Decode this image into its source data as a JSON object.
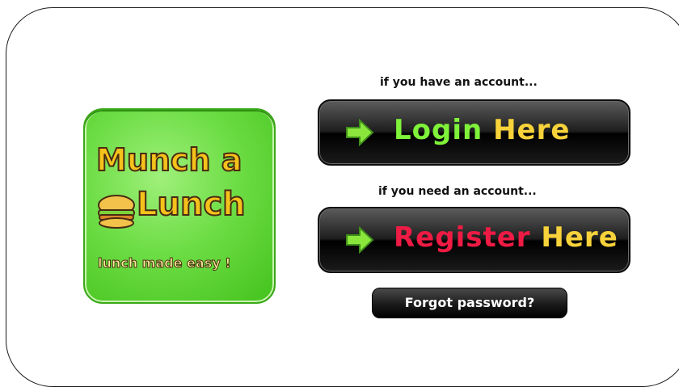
{
  "logo": {
    "line1": "Munch a",
    "line2": "Lunch",
    "tagline": "lunch made easy !"
  },
  "login": {
    "hint": "if you have an account...",
    "word1": "Login",
    "word2": "Here"
  },
  "register": {
    "hint": "if you need an account...",
    "word1": "Register",
    "word2": "Here"
  },
  "forgot": {
    "label": "Forgot password?"
  },
  "icons": {
    "arrow": "right-arrow-icon",
    "sandwich": "sandwich-icon"
  },
  "colors": {
    "logo_green": "#6ddd45",
    "logo_text": "#f5c21b",
    "login_word": "#7ff23a",
    "register_word": "#ee1b44",
    "here_word": "#f7d23a",
    "button_dark": "#1e1e1e"
  }
}
